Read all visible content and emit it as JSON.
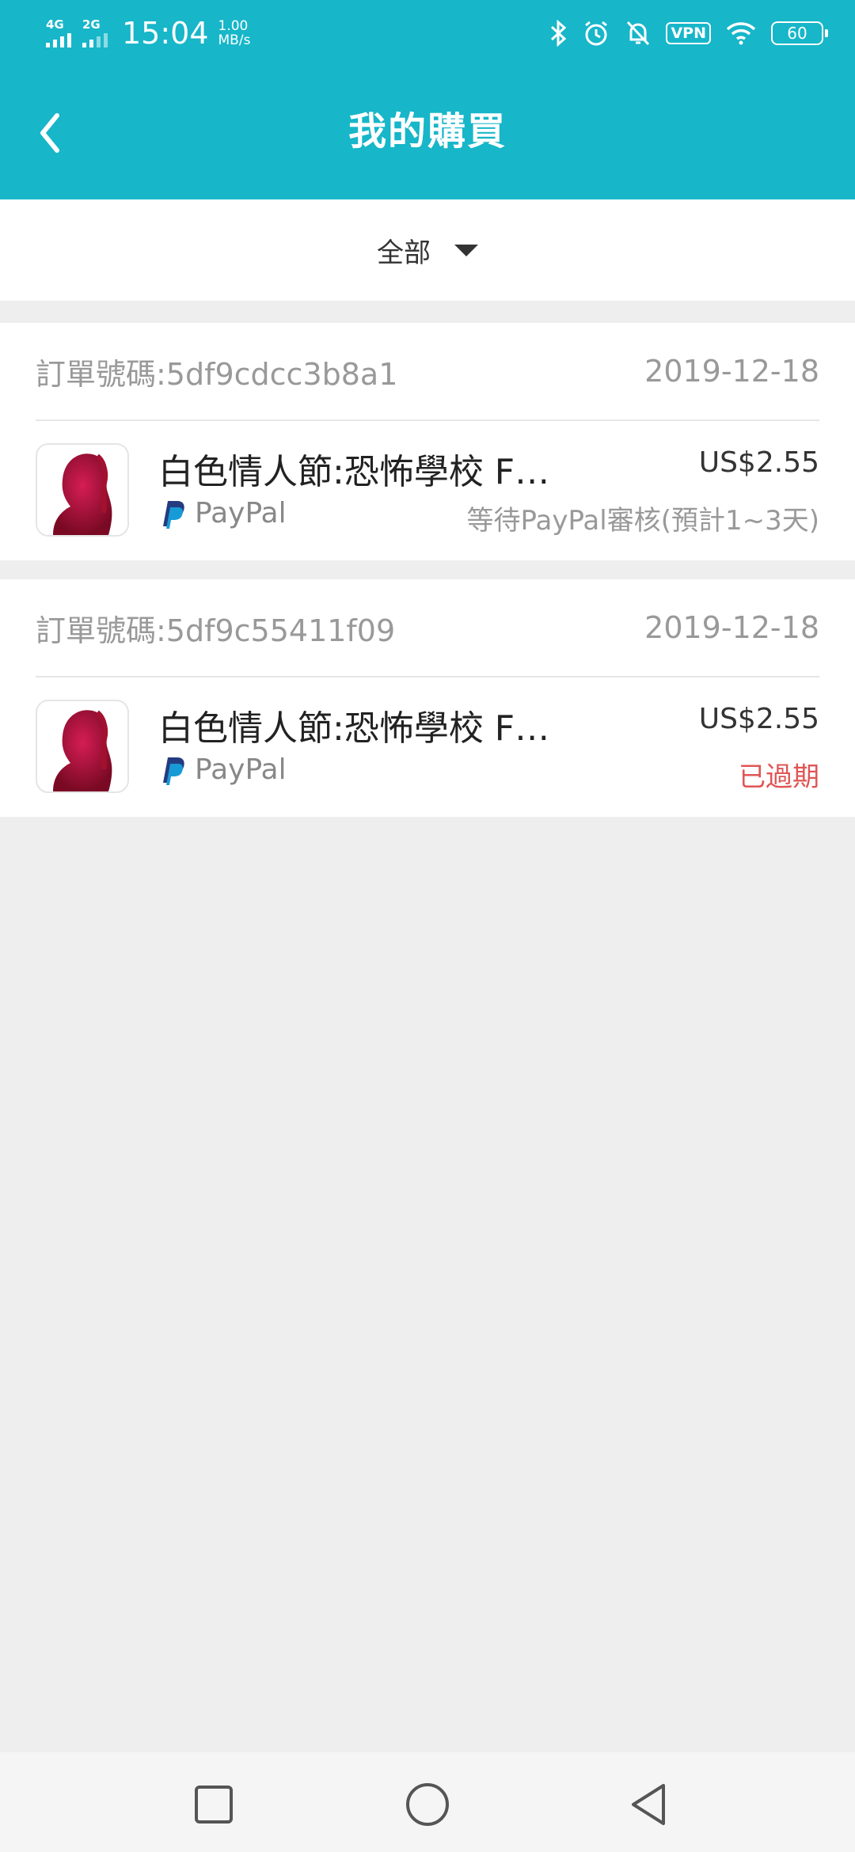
{
  "status_bar": {
    "network1": "4G",
    "network2": "2G",
    "time": "15:04",
    "speed_value": "1.00",
    "speed_unit": "MB/s",
    "vpn_label": "VPN",
    "battery": "60"
  },
  "header": {
    "title": "我的購買"
  },
  "filter": {
    "selected": "全部"
  },
  "orders": [
    {
      "order_label": "訂單號碼:5df9cdcc3b8a1",
      "date": "2019-12-18",
      "title": "白色情人節:恐怖學校 F…",
      "payment": "PayPal",
      "price": "US$2.55",
      "status": "等待PayPal審核(預計1~3天)"
    },
    {
      "order_label": "訂單號碼:5df9c55411f09",
      "date": "2019-12-18",
      "title": "白色情人節:恐怖學校 F…",
      "payment": "PayPal",
      "price": "US$2.55",
      "status": "已過期"
    }
  ],
  "colors": {
    "accent": "#17b6c9",
    "expired": "#e05555",
    "background": "#eeeeee"
  }
}
